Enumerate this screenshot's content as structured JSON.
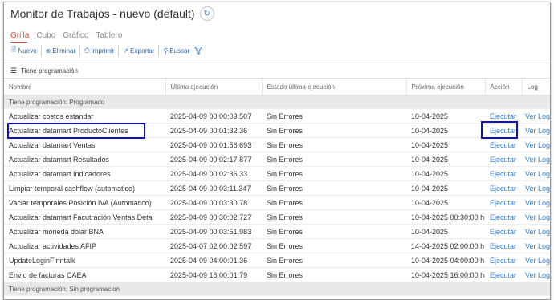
{
  "window": {
    "title": "Monitor de Trabajos - nuevo (default)"
  },
  "tabs": [
    {
      "label": "Grilla",
      "active": true
    },
    {
      "label": "Cubo",
      "active": false
    },
    {
      "label": "Gráfico",
      "active": false
    },
    {
      "label": "Tablero",
      "active": false
    }
  ],
  "toolbar": {
    "nuevo": "Nuevo",
    "eliminar": "Eliminar",
    "imprimir": "Imprimir",
    "exportar": "Exportar",
    "buscar": "Buscar"
  },
  "grouping": {
    "label": "Tiene programación"
  },
  "columns": [
    "Nombre",
    "Última ejecución",
    "Estado última ejecución",
    "Próxima ejecución",
    "Acción",
    "Log"
  ],
  "groups": [
    {
      "label": "Tiene programación: Programado"
    },
    {
      "label": "Tiene programación: Sin programacion"
    }
  ],
  "rows": [
    {
      "nombre": "Actualizar costos estandar",
      "ultima": "2025-04-09 00:00:09.507",
      "estado": "Sin Errores",
      "proxima": "10-04-2025",
      "accion": "Ejecutar",
      "log": "Ver Log"
    },
    {
      "nombre": "Actualizar datamart ProductoClientes",
      "ultima": "2025-04-09 00:01:32.36",
      "estado": "Sin Errores",
      "proxima": "10-04-2025",
      "accion": "Ejecutar",
      "log": "Ver Log"
    },
    {
      "nombre": "Actualizar datamart Ventas",
      "ultima": "2025-04-09 00:01:56.693",
      "estado": "Sin Errores",
      "proxima": "10-04-2025",
      "accion": "Ejecutar",
      "log": "Ver Log"
    },
    {
      "nombre": "Actualizar datamart Resultados",
      "ultima": "2025-04-09 00:02:17.877",
      "estado": "Sin Errores",
      "proxima": "10-04-2025",
      "accion": "Ejecutar",
      "log": "Ver Log"
    },
    {
      "nombre": "Actualizar datamart Indicadores",
      "ultima": "2025-04-09 00:02:36.33",
      "estado": "Sin Errores",
      "proxima": "10-04-2025",
      "accion": "Ejecutar",
      "log": "Ver Log"
    },
    {
      "nombre": "Limpiar temporal cashflow (automatico)",
      "ultima": "2025-04-09 00:03:11.347",
      "estado": "Sin Errores",
      "proxima": "10-04-2025",
      "accion": "Ejecutar",
      "log": "Ver Log"
    },
    {
      "nombre": "Vaciar temporales Posición IVA (Automatico)",
      "ultima": "2025-04-09 00:03:30.78",
      "estado": "Sin Errores",
      "proxima": "10-04-2025",
      "accion": "Ejecutar",
      "log": "Ver Log"
    },
    {
      "nombre": "Actualizar datamart Facutración Ventas Deta",
      "ultima": "2025-04-09 00:30:02.727",
      "estado": "Sin Errores",
      "proxima": "10-04-2025 00:30:00 h",
      "accion": "Ejecutar",
      "log": "Ver Log"
    },
    {
      "nombre": "Actualizar moneda dolar BNA",
      "ultima": "2025-04-09 00:03:51.983",
      "estado": "Sin Errores",
      "proxima": "10-04-2025",
      "accion": "Ejecutar",
      "log": "Ver Log"
    },
    {
      "nombre": "Actualizar actividades AFIP",
      "ultima": "2025-04-07 02:00:02.597",
      "estado": "Sin Errores",
      "proxima": "14-04-2025 02:00:00 h",
      "accion": "Ejecutar",
      "log": "Ver Log"
    },
    {
      "nombre": "UpdateLoginFinntalk",
      "ultima": "2025-04-09 04:00:01.36",
      "estado": "Sin Errores",
      "proxima": "10-04-2025 04:00:00 h",
      "accion": "Ejecutar",
      "log": "Ver Log"
    },
    {
      "nombre": "Envio de facturas CAEA",
      "ultima": "2025-04-09 16:00:01.79",
      "estado": "Sin Errores",
      "proxima": "10-04-2025 16:00:00 hs",
      "accion": "Ejecutar",
      "log": "Ver Log"
    }
  ],
  "colors": {
    "accent": "#e04a3a",
    "link": "#2f7fd1",
    "highlight": "#1010c8"
  }
}
